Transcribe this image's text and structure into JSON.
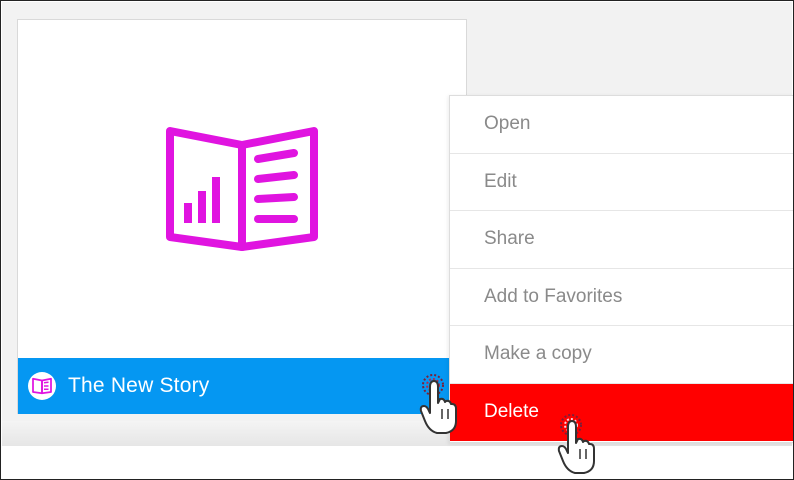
{
  "card": {
    "title": "The New Story",
    "icon": "story-book-icon",
    "footer_color": "#0597f2",
    "icon_color": "#e014e0"
  },
  "context_menu": {
    "items": [
      {
        "label": "Open"
      },
      {
        "label": "Edit"
      },
      {
        "label": "Share"
      },
      {
        "label": "Add to Favorites"
      },
      {
        "label": "Make a copy"
      },
      {
        "label": "Delete",
        "highlight_color": "#ff0000"
      }
    ]
  }
}
